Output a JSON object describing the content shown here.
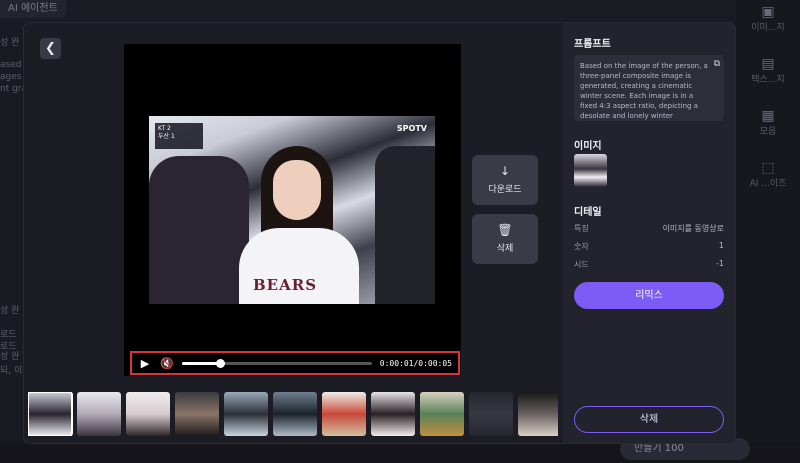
{
  "background": {
    "top_pill": "AI 에이전트",
    "left_texts": [
      "성 완",
      "ased o",
      "ages",
      "nt gra",
      "성 완",
      "성 완",
      "로드",
      "로드",
      "되, 이"
    ],
    "right_items": [
      {
        "icon": "image-icon",
        "label": "이미...지"
      },
      {
        "icon": "text-icon",
        "label": "텍스...지"
      },
      {
        "icon": "grid-icon",
        "label": "모음"
      },
      {
        "icon": "crop-icon",
        "label": "AI ...이즈"
      }
    ],
    "generate_label": "만들기  100"
  },
  "modal": {
    "back_icon": "chevron-left-icon",
    "player": {
      "scoreboard": [
        "KT  2",
        "두산  1"
      ],
      "broadcaster": "SPOTV",
      "jersey_text": "BEARS",
      "current_time": "0:00:01",
      "duration": "0:00:05",
      "time_display": "0:00:01/0:00:05",
      "progress_fraction": 0.2
    },
    "actions": {
      "download_label": "다운로드",
      "delete_label": "삭제"
    },
    "thumbnails": [
      {
        "selected": true,
        "caption": "",
        "colors": [
          "#cfd0da",
          "#2a2330",
          "#f2f0f4"
        ]
      },
      {
        "selected": false,
        "caption": "",
        "colors": [
          "#e9e7ee",
          "#b2aab4",
          "#3a3440"
        ]
      },
      {
        "selected": false,
        "caption": "",
        "colors": [
          "#efecef",
          "#d8ccd0",
          "#2c2628"
        ]
      },
      {
        "selected": false,
        "caption": "",
        "colors": [
          "#3a3a40",
          "#8a7468",
          "#1e1a1c"
        ]
      },
      {
        "selected": false,
        "caption": "",
        "colors": [
          "#9aa8b8",
          "#2c3038",
          "#c8d4e0"
        ]
      },
      {
        "selected": false,
        "caption": "",
        "colors": [
          "#6f8090",
          "#1c2228",
          "#b0bcc8"
        ]
      },
      {
        "selected": false,
        "caption": "",
        "colors": [
          "#f0eee8",
          "#c84838",
          "#d0c0a0"
        ]
      },
      {
        "selected": false,
        "caption": "",
        "colors": [
          "#e8e4ea",
          "#2a2024",
          "#f4eef0"
        ]
      },
      {
        "selected": false,
        "caption": "",
        "colors": [
          "#d8d0c0",
          "#5a8058",
          "#c09040"
        ]
      },
      {
        "selected": false,
        "caption": "",
        "colors": [
          "#26262e",
          "#383842",
          "#26262e"
        ]
      },
      {
        "selected": false,
        "caption": "",
        "colors": [
          "#181818",
          "#6a6060",
          "#d8d0c8"
        ]
      }
    ],
    "panel": {
      "prompt_title": "프롬프트",
      "prompt_text": "Based on the image of the person, a three-panel composite image is generated, creating a cinematic winter scene. Each image is in a fixed 4:3 aspect ratio, depicting a desolate and lonely winter",
      "image_title": "이미지",
      "detail_title": "디테일",
      "details": [
        {
          "label": "특징",
          "value": "이미지를 동영상로"
        },
        {
          "label": "숫자",
          "value": "1"
        },
        {
          "label": "시드",
          "value": "-1"
        }
      ],
      "remix_label": "리믹스",
      "delete_label": "삭제"
    }
  }
}
